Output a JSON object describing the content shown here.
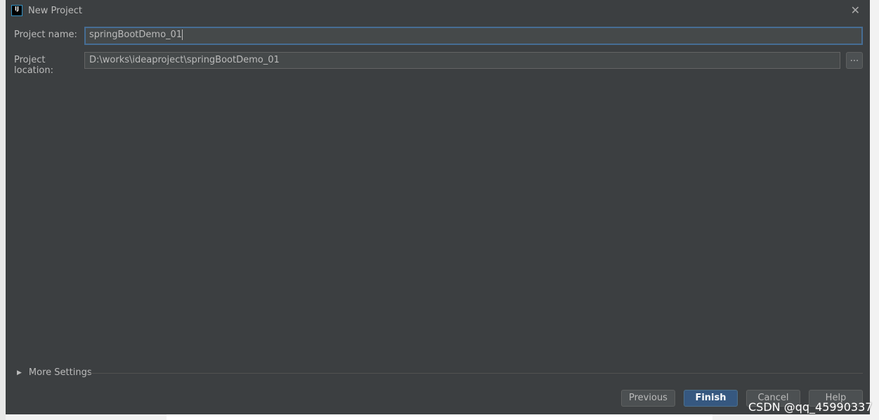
{
  "dialog": {
    "title": "New Project",
    "logo_text": "IJ"
  },
  "form": {
    "name_label": "Project name:",
    "name_value": "springBootDemo_01",
    "location_label": "Project location:",
    "location_value": "D:\\works\\ideaproject\\springBootDemo_01",
    "browse_label": "..."
  },
  "more_settings": "More Settings",
  "buttons": {
    "previous": "Previous",
    "finish": "Finish",
    "cancel": "Cancel",
    "help": "Help"
  },
  "watermark": "CSDN @qq_45990337"
}
